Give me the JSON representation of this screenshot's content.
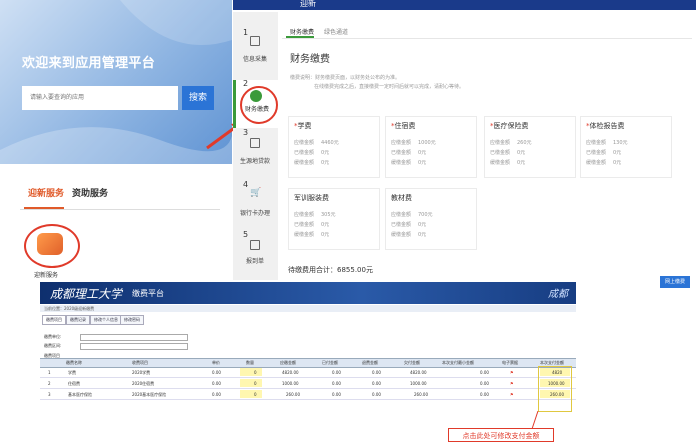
{
  "portal": {
    "title": "欢迎来到应用管理平台",
    "search_placeholder": "请输入要查询的应用",
    "search_button": "搜索",
    "tabs": [
      "迎新服务",
      "资助服务"
    ],
    "app_label": "迎新服务"
  },
  "steps": {
    "header_title": "迎新",
    "items": [
      {
        "num": "1",
        "label": "信息采集"
      },
      {
        "num": "2",
        "label": "财务缴费"
      },
      {
        "num": "3",
        "label": "生源地贷款"
      },
      {
        "num": "4",
        "label": "银行卡办理"
      },
      {
        "num": "5",
        "label": "报到单"
      }
    ],
    "tabs": [
      "财务缴费",
      "绿色通道"
    ],
    "section_title": "财务缴费",
    "hint_lines": [
      "缴费说明：财务缴费页面，以财务处公布的为准。",
      "在线缴费完成之后，直接缴费一定时间后就可以完成，请耐心等待。"
    ],
    "row_labels": [
      "应缴金额",
      "已缴金额",
      "缓缴金额"
    ],
    "fees": [
      {
        "name": "学费",
        "values": [
          "4460元",
          "0元",
          "0元"
        ]
      },
      {
        "name": "住宿费",
        "values": [
          "1000元",
          "0元",
          "0元"
        ]
      },
      {
        "name": "医疗保险费",
        "values": [
          "260元",
          "0元",
          "0元"
        ]
      },
      {
        "name": "体检报告费",
        "values": [
          "130元",
          "0元",
          "0元"
        ]
      },
      {
        "name": "军训服装费",
        "values": [
          "305元",
          "0元",
          "0元"
        ]
      },
      {
        "name": "教材费",
        "values": [
          "700元",
          "0元",
          "0元"
        ]
      }
    ],
    "total": "待缴费用合计：6855.00元",
    "pay_button": "网上缴费"
  },
  "legacy": {
    "logo": "成都理工大学",
    "system_name": "缴费平台",
    "crumb": "当前位置：2020级迎新缴费",
    "tabs": [
      "缴费项目",
      "缴费记录",
      "修改个人信息",
      "修改密码"
    ],
    "fields": [
      "缴费单位:",
      "缴费区间:"
    ],
    "list_title": "缴费项目",
    "columns": [
      "缴费名称",
      "收费项目",
      "单价",
      "数量",
      "应缴金额",
      "已付金额",
      "退费金额",
      "欠付金额",
      "本次支付最小金额",
      "电子票据",
      "本次支付金额"
    ],
    "rows": [
      {
        "idx": "1",
        "name": "学费",
        "item": "2020学费",
        "price": "0.00",
        "qty": "0",
        "due": "4820.00",
        "paid": "0.00",
        "refund": "0.00",
        "owed": "4820.00",
        "min": "0.00",
        "pay": "4820"
      },
      {
        "idx": "2",
        "name": "住宿费",
        "item": "2020住宿费",
        "price": "0.00",
        "qty": "0",
        "due": "1000.00",
        "paid": "0.00",
        "refund": "0.00",
        "owed": "1000.00",
        "min": "0.00",
        "pay": "1000.00"
      },
      {
        "idx": "3",
        "name": "基本医疗保险",
        "item": "2020基本医疗保险",
        "price": "0.00",
        "qty": "0",
        "due": "260.00",
        "paid": "0.00",
        "refund": "0.00",
        "owed": "260.00",
        "min": "0.00",
        "pay": "260.00"
      }
    ],
    "callout": "点击此处可修改支付金额"
  },
  "colors": {
    "accent_blue": "#2b74d6",
    "accent_red": "#e03a2a",
    "accent_green": "#3a9a3a",
    "header_navy": "#1a3a8a"
  }
}
